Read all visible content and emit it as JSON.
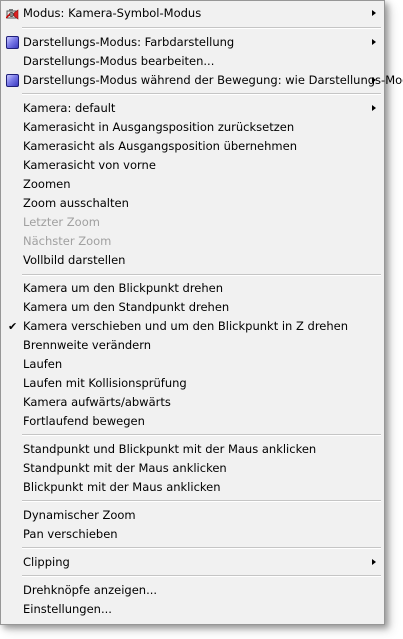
{
  "menu": {
    "mode": {
      "label": "Modus:  Kamera-Symbol-Modus",
      "has_submenu": true,
      "icon": "camera-symbol-mode-icon"
    },
    "display_mode": {
      "label": "Darstellungs-Modus: Farbdarstellung",
      "has_submenu": true,
      "icon": "cube-icon"
    },
    "edit_display_mode": {
      "label": "Darstellungs-Modus bearbeiten..."
    },
    "display_mode_motion": {
      "label": "Darstellungs-Modus während der Bewegung: wie Darstellungs-Modus",
      "has_submenu": true,
      "icon": "cube-icon"
    },
    "camera_items": [
      {
        "label": "Kamera: default",
        "has_submenu": true,
        "enabled": true
      },
      {
        "label": "Kamerasicht in Ausgangsposition zurücksetzen",
        "enabled": true
      },
      {
        "label": "Kamerasicht als Ausgangsposition übernehmen",
        "enabled": true
      },
      {
        "label": "Kamerasicht von vorne",
        "enabled": true
      },
      {
        "label": "Zoomen",
        "enabled": true
      },
      {
        "label": "Zoom ausschalten",
        "enabled": true
      },
      {
        "label": "Letzter Zoom",
        "enabled": false
      },
      {
        "label": "Nächster Zoom",
        "enabled": false
      },
      {
        "label": "Vollbild darstellen",
        "enabled": true
      }
    ],
    "navigation_items": [
      {
        "label": "Kamera um den Blickpunkt drehen",
        "checked": false
      },
      {
        "label": "Kamera um den Standpunkt drehen",
        "checked": false
      },
      {
        "label": "Kamera verschieben und um den Blickpunkt in Z drehen",
        "checked": true
      },
      {
        "label": "Brennweite verändern",
        "checked": false
      },
      {
        "label": "Laufen",
        "checked": false
      },
      {
        "label": "Laufen mit Kollisionsprüfung",
        "checked": false
      },
      {
        "label": "Kamera aufwärts/abwärts",
        "checked": false
      },
      {
        "label": "Fortlaufend bewegen",
        "checked": false
      }
    ],
    "mouse_items": [
      {
        "label": "Standpunkt und Blickpunkt mit der Maus anklicken"
      },
      {
        "label": "Standpunkt mit der Maus anklicken"
      },
      {
        "label": "Blickpunkt mit der Maus anklicken"
      }
    ],
    "zoom_items": [
      {
        "label": "Dynamischer Zoom"
      },
      {
        "label": "Pan verschieben"
      }
    ],
    "clipping": {
      "label": "Clipping",
      "has_submenu": true
    },
    "settings_items": [
      {
        "label": "Drehknöpfe anzeigen..."
      },
      {
        "label": "Einstellungen..."
      }
    ],
    "checkmark_glyph": "✔"
  }
}
